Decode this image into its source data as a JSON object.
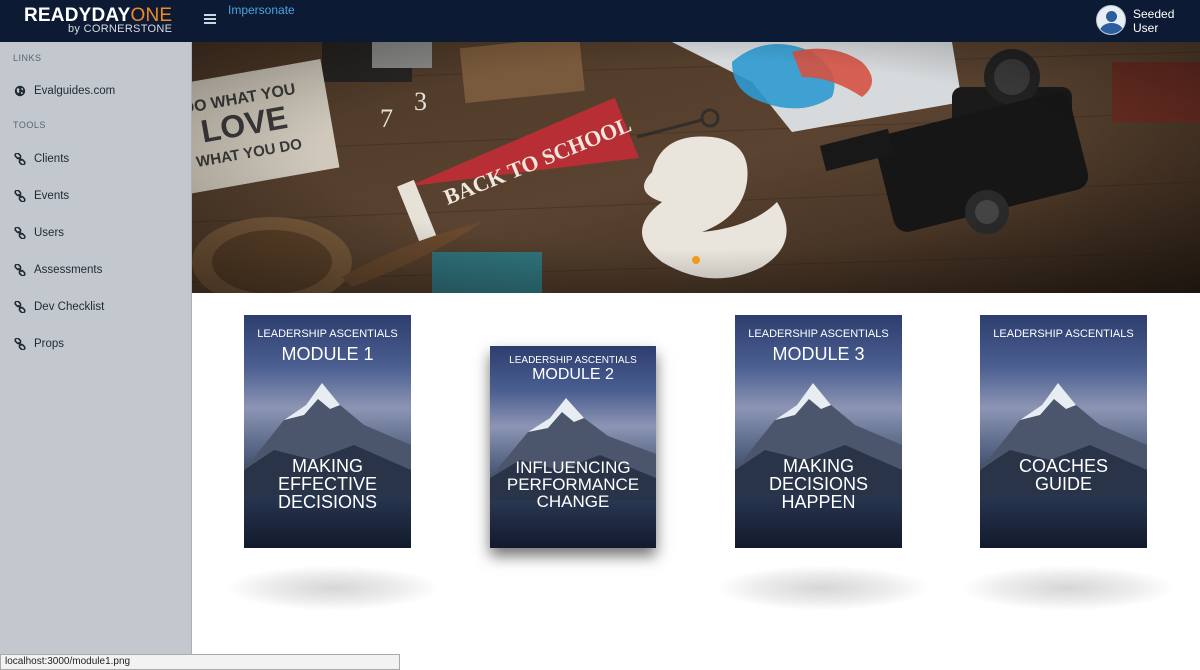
{
  "header": {
    "logo_ready": "READYDAY",
    "logo_one": "ONE",
    "logo_sub": "by CORNERSTONE",
    "impersonate": "Impersonate",
    "user_name": "Seeded User"
  },
  "sidebar": {
    "links_title": "LINKS",
    "links": [
      {
        "label": "Evalguides.com",
        "icon": "globe-icon"
      }
    ],
    "tools_title": "TOOLS",
    "tools": [
      {
        "label": "Clients",
        "icon": "link-icon"
      },
      {
        "label": "Events",
        "icon": "link-icon"
      },
      {
        "label": "Users",
        "icon": "link-icon"
      },
      {
        "label": "Assessments",
        "icon": "link-icon"
      },
      {
        "label": "Dev Checklist",
        "icon": "link-icon"
      },
      {
        "label": "Props",
        "icon": "link-icon"
      }
    ]
  },
  "hero": {
    "image": "desk-photo",
    "slides": 1,
    "active_slide": 1
  },
  "books": [
    {
      "series": "LEADERSHIP ASCENTIALS",
      "module": "MODULE 1",
      "title": [
        "MAKING",
        "EFFECTIVE",
        "DECISIONS"
      ]
    },
    {
      "series": "LEADERSHIP ASCENTIALS",
      "module": "MODULE 2",
      "title": [
        "INFLUENCING",
        "PERFORMANCE",
        "CHANGE"
      ]
    },
    {
      "series": "LEADERSHIP ASCENTIALS",
      "module": "MODULE 3",
      "title": [
        "MAKING",
        "DECISIONS",
        "HAPPEN"
      ]
    },
    {
      "series": "LEADERSHIP ASCENTIALS",
      "module": "",
      "title": [
        "COACHES",
        "GUIDE"
      ]
    }
  ],
  "statusbar": {
    "url": "localhost:3000/module1.png"
  },
  "colors": {
    "topbar": "#0d1a33",
    "sidebar": "#c2c8ce",
    "accent_orange": "#f08a24",
    "link_blue": "#4aa3df"
  }
}
